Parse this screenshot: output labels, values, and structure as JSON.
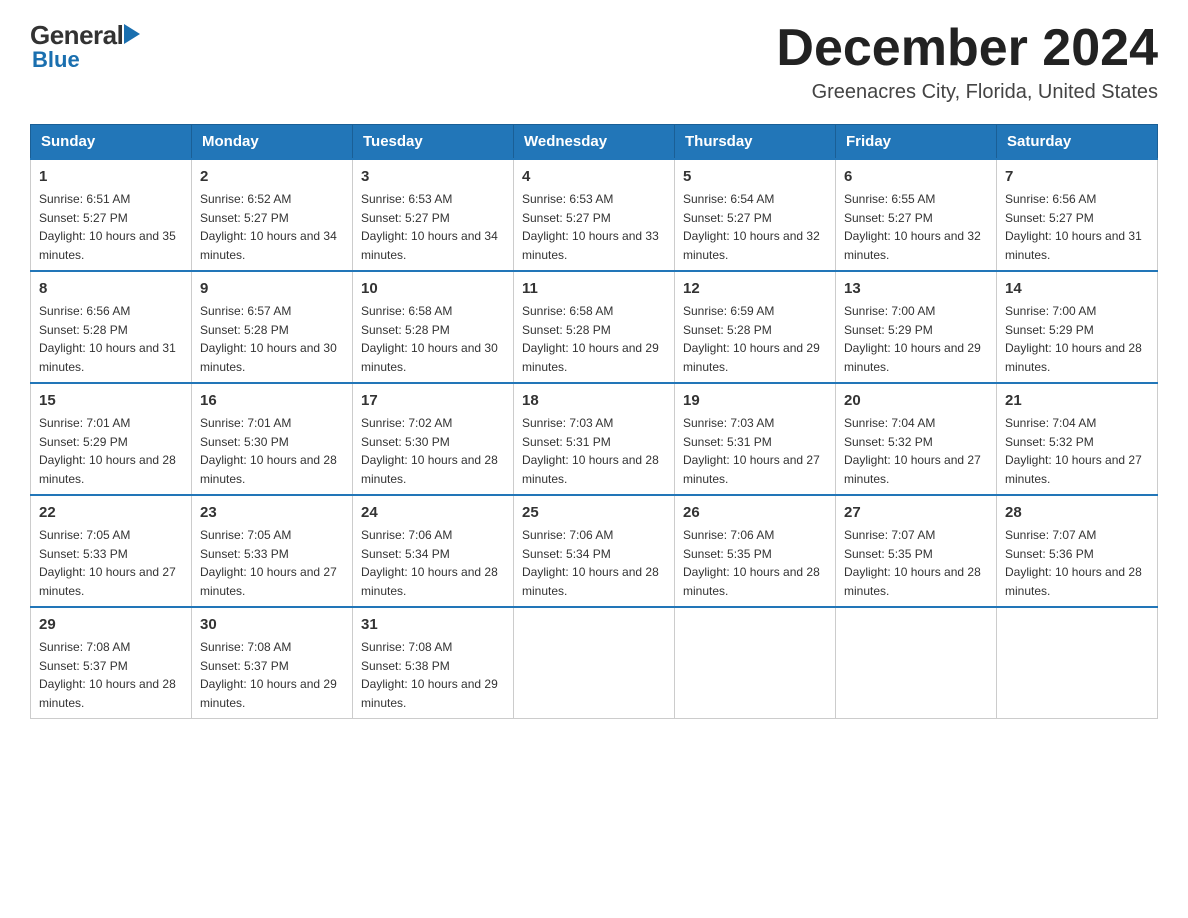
{
  "logo": {
    "general": "General",
    "blue": "Blue",
    "arrow": "▶"
  },
  "header": {
    "month_year": "December 2024",
    "location": "Greenacres City, Florida, United States"
  },
  "days_of_week": [
    "Sunday",
    "Monday",
    "Tuesday",
    "Wednesday",
    "Thursday",
    "Friday",
    "Saturday"
  ],
  "weeks": [
    [
      {
        "day": "1",
        "sunrise": "6:51 AM",
        "sunset": "5:27 PM",
        "daylight": "10 hours and 35 minutes."
      },
      {
        "day": "2",
        "sunrise": "6:52 AM",
        "sunset": "5:27 PM",
        "daylight": "10 hours and 34 minutes."
      },
      {
        "day": "3",
        "sunrise": "6:53 AM",
        "sunset": "5:27 PM",
        "daylight": "10 hours and 34 minutes."
      },
      {
        "day": "4",
        "sunrise": "6:53 AM",
        "sunset": "5:27 PM",
        "daylight": "10 hours and 33 minutes."
      },
      {
        "day": "5",
        "sunrise": "6:54 AM",
        "sunset": "5:27 PM",
        "daylight": "10 hours and 32 minutes."
      },
      {
        "day": "6",
        "sunrise": "6:55 AM",
        "sunset": "5:27 PM",
        "daylight": "10 hours and 32 minutes."
      },
      {
        "day": "7",
        "sunrise": "6:56 AM",
        "sunset": "5:27 PM",
        "daylight": "10 hours and 31 minutes."
      }
    ],
    [
      {
        "day": "8",
        "sunrise": "6:56 AM",
        "sunset": "5:28 PM",
        "daylight": "10 hours and 31 minutes."
      },
      {
        "day": "9",
        "sunrise": "6:57 AM",
        "sunset": "5:28 PM",
        "daylight": "10 hours and 30 minutes."
      },
      {
        "day": "10",
        "sunrise": "6:58 AM",
        "sunset": "5:28 PM",
        "daylight": "10 hours and 30 minutes."
      },
      {
        "day": "11",
        "sunrise": "6:58 AM",
        "sunset": "5:28 PM",
        "daylight": "10 hours and 29 minutes."
      },
      {
        "day": "12",
        "sunrise": "6:59 AM",
        "sunset": "5:28 PM",
        "daylight": "10 hours and 29 minutes."
      },
      {
        "day": "13",
        "sunrise": "7:00 AM",
        "sunset": "5:29 PM",
        "daylight": "10 hours and 29 minutes."
      },
      {
        "day": "14",
        "sunrise": "7:00 AM",
        "sunset": "5:29 PM",
        "daylight": "10 hours and 28 minutes."
      }
    ],
    [
      {
        "day": "15",
        "sunrise": "7:01 AM",
        "sunset": "5:29 PM",
        "daylight": "10 hours and 28 minutes."
      },
      {
        "day": "16",
        "sunrise": "7:01 AM",
        "sunset": "5:30 PM",
        "daylight": "10 hours and 28 minutes."
      },
      {
        "day": "17",
        "sunrise": "7:02 AM",
        "sunset": "5:30 PM",
        "daylight": "10 hours and 28 minutes."
      },
      {
        "day": "18",
        "sunrise": "7:03 AM",
        "sunset": "5:31 PM",
        "daylight": "10 hours and 28 minutes."
      },
      {
        "day": "19",
        "sunrise": "7:03 AM",
        "sunset": "5:31 PM",
        "daylight": "10 hours and 27 minutes."
      },
      {
        "day": "20",
        "sunrise": "7:04 AM",
        "sunset": "5:32 PM",
        "daylight": "10 hours and 27 minutes."
      },
      {
        "day": "21",
        "sunrise": "7:04 AM",
        "sunset": "5:32 PM",
        "daylight": "10 hours and 27 minutes."
      }
    ],
    [
      {
        "day": "22",
        "sunrise": "7:05 AM",
        "sunset": "5:33 PM",
        "daylight": "10 hours and 27 minutes."
      },
      {
        "day": "23",
        "sunrise": "7:05 AM",
        "sunset": "5:33 PM",
        "daylight": "10 hours and 27 minutes."
      },
      {
        "day": "24",
        "sunrise": "7:06 AM",
        "sunset": "5:34 PM",
        "daylight": "10 hours and 28 minutes."
      },
      {
        "day": "25",
        "sunrise": "7:06 AM",
        "sunset": "5:34 PM",
        "daylight": "10 hours and 28 minutes."
      },
      {
        "day": "26",
        "sunrise": "7:06 AM",
        "sunset": "5:35 PM",
        "daylight": "10 hours and 28 minutes."
      },
      {
        "day": "27",
        "sunrise": "7:07 AM",
        "sunset": "5:35 PM",
        "daylight": "10 hours and 28 minutes."
      },
      {
        "day": "28",
        "sunrise": "7:07 AM",
        "sunset": "5:36 PM",
        "daylight": "10 hours and 28 minutes."
      }
    ],
    [
      {
        "day": "29",
        "sunrise": "7:08 AM",
        "sunset": "5:37 PM",
        "daylight": "10 hours and 28 minutes."
      },
      {
        "day": "30",
        "sunrise": "7:08 AM",
        "sunset": "5:37 PM",
        "daylight": "10 hours and 29 minutes."
      },
      {
        "day": "31",
        "sunrise": "7:08 AM",
        "sunset": "5:38 PM",
        "daylight": "10 hours and 29 minutes."
      },
      null,
      null,
      null,
      null
    ]
  ],
  "labels": {
    "sunrise_prefix": "Sunrise: ",
    "sunset_prefix": "Sunset: ",
    "daylight_prefix": "Daylight: "
  }
}
